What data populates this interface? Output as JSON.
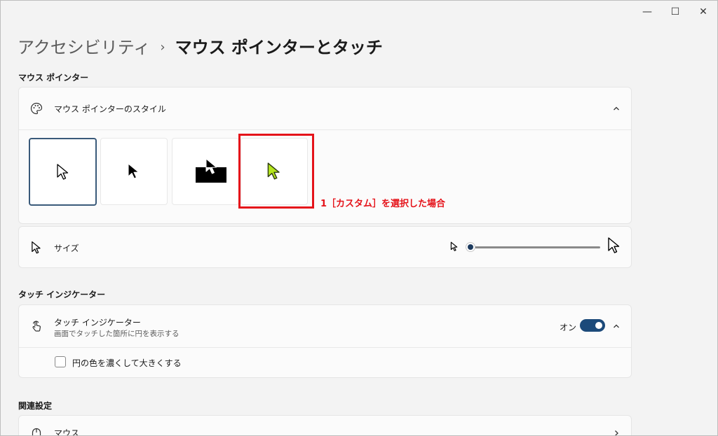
{
  "window": {
    "minimize": "—",
    "maximize": "☐",
    "close": "✕"
  },
  "breadcrumb": {
    "parent": "アクセシビリティ",
    "separator": "›",
    "current": "マウス ポインターとタッチ"
  },
  "sections": {
    "pointer": "マウス ポインター",
    "touch": "タッチ インジケーター",
    "related": "関連設定"
  },
  "pointer_style": {
    "label": "マウス ポインターのスタイル",
    "icon": "palette-icon",
    "expanded": true,
    "options": [
      {
        "name": "白",
        "selected": true
      },
      {
        "name": "黒",
        "selected": false
      },
      {
        "name": "反転",
        "selected": false
      },
      {
        "name": "カスタム",
        "selected": false,
        "color": "#b5e61d"
      }
    ]
  },
  "annotation": "1［カスタム］を選択した場合",
  "size": {
    "label": "サイズ",
    "icon": "pointer-icon",
    "value": 1
  },
  "touch": {
    "title": "タッチ インジケーター",
    "subtitle": "画面でタッチした箇所に円を表示する",
    "icon": "touch-icon",
    "toggle_label": "オン",
    "toggle_on": true,
    "checkbox_label": "円の色を濃くして大きくする",
    "checkbox_checked": false
  },
  "related": {
    "mouse_label": "マウス",
    "icon": "mouse-icon"
  },
  "colors": {
    "accent": "#1c4a7a",
    "highlight": "#e5131a",
    "custom_pointer": "#b5e61d"
  }
}
